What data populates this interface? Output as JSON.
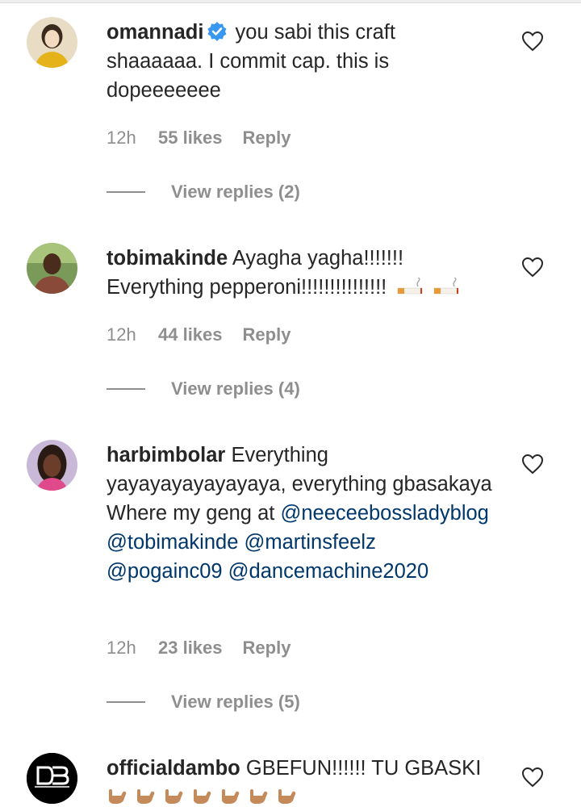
{
  "comments": [
    {
      "username": "omannadi",
      "verified": true,
      "text": "you sabi this craft shaaaaaa. I commit cap. this is dopeeeeeee",
      "time": "12h",
      "likes": "55 likes",
      "reply": "Reply",
      "view_replies": "View replies (2)",
      "avatar": "woman-yellow-top-avatar"
    },
    {
      "username": "tobimakinde",
      "verified": false,
      "text": "Ayagha yagha!!!!!!! Everything pepperoni!!!!!!!!!!!!!!!",
      "emoji": [
        "cigarette-emoji",
        "cigarette-emoji"
      ],
      "time": "12h",
      "likes": "44 likes",
      "reply": "Reply",
      "view_replies": "View replies (4)",
      "avatar": "man-outdoors-avatar"
    },
    {
      "username": "harbimbolar",
      "verified": false,
      "text": "Everything yayayayayayayaya, everything gbasakaya Where my geng at",
      "mentions": [
        "@neeceebossladyblog",
        "@tobimakinde",
        "@martinsfeelz",
        "@pogainc09",
        "@dancemachine2020"
      ],
      "time": "12h",
      "likes": "23 likes",
      "reply": "Reply",
      "view_replies": "View replies (5)",
      "avatar": "woman-portrait-avatar"
    },
    {
      "username": "officialdambo",
      "verified": false,
      "text": "GBEFUN!!!!!! TU GBASKI",
      "emoji_count": 7,
      "emoji": "call-me-hand-emoji",
      "avatar": "dambo-logo-avatar",
      "avatar_caption": "DAMBO"
    }
  ],
  "colors": {
    "text": "#262626",
    "secondary": "#8e8e8e",
    "mention": "#00376b",
    "verified": "#3897f0"
  }
}
